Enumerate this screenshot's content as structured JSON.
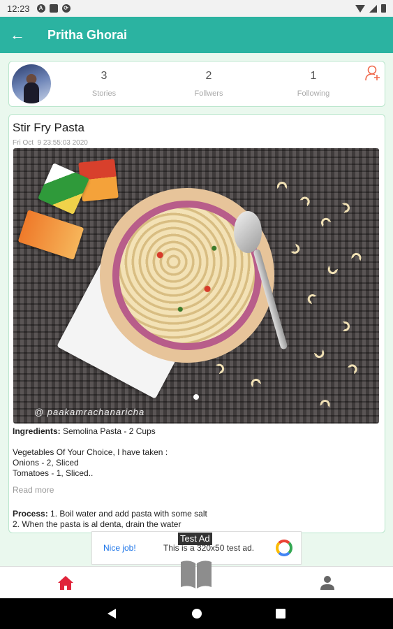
{
  "status_bar": {
    "time": "12:23",
    "icons": [
      "android-icon",
      "sd-card-icon",
      "sync-icon",
      "wifi-icon",
      "signal-icon",
      "battery-icon"
    ]
  },
  "app_bar": {
    "title": "Pritha Ghorai",
    "back_icon": "arrow-left-icon",
    "color": "#2bb3a1"
  },
  "profile": {
    "stories_count": "3",
    "stories_label": "Stories",
    "followers_count": "2",
    "followers_label": "Follwers",
    "following_count": "1",
    "following_label": "Following",
    "add_user_icon": "person-add-icon"
  },
  "post": {
    "title": "Stir Fry Pasta",
    "date": "Fri Oct  9 23:55:03 2020",
    "image_watermark": "@ paakamrachanaricha",
    "ingredients_label": "Ingredients:",
    "ingredients_first": " Semolina Pasta - 2 Cups",
    "veg_line": "Vegetables Of Your Choice, I have taken :",
    "onions_line": "Onions - 2, Sliced",
    "tomatoes_line": "Tomatoes - 1, Sliced..",
    "read_more": "Read more",
    "process_label": "Process:",
    "process_first": " 1. Boil water and add pasta with some salt",
    "process_second": "2. When the pasta is al denta, drain the water"
  },
  "ad": {
    "label": "Test Ad",
    "cta": "Nice job!",
    "text": "This is a 320x50 test ad."
  },
  "bottom_nav": {
    "items": [
      "home-icon",
      "book-open-icon",
      "person-icon"
    ],
    "active_color": "#e0243a"
  },
  "system_nav": {
    "items": [
      "back-triangle-icon",
      "home-circle-icon",
      "recents-square-icon"
    ]
  }
}
